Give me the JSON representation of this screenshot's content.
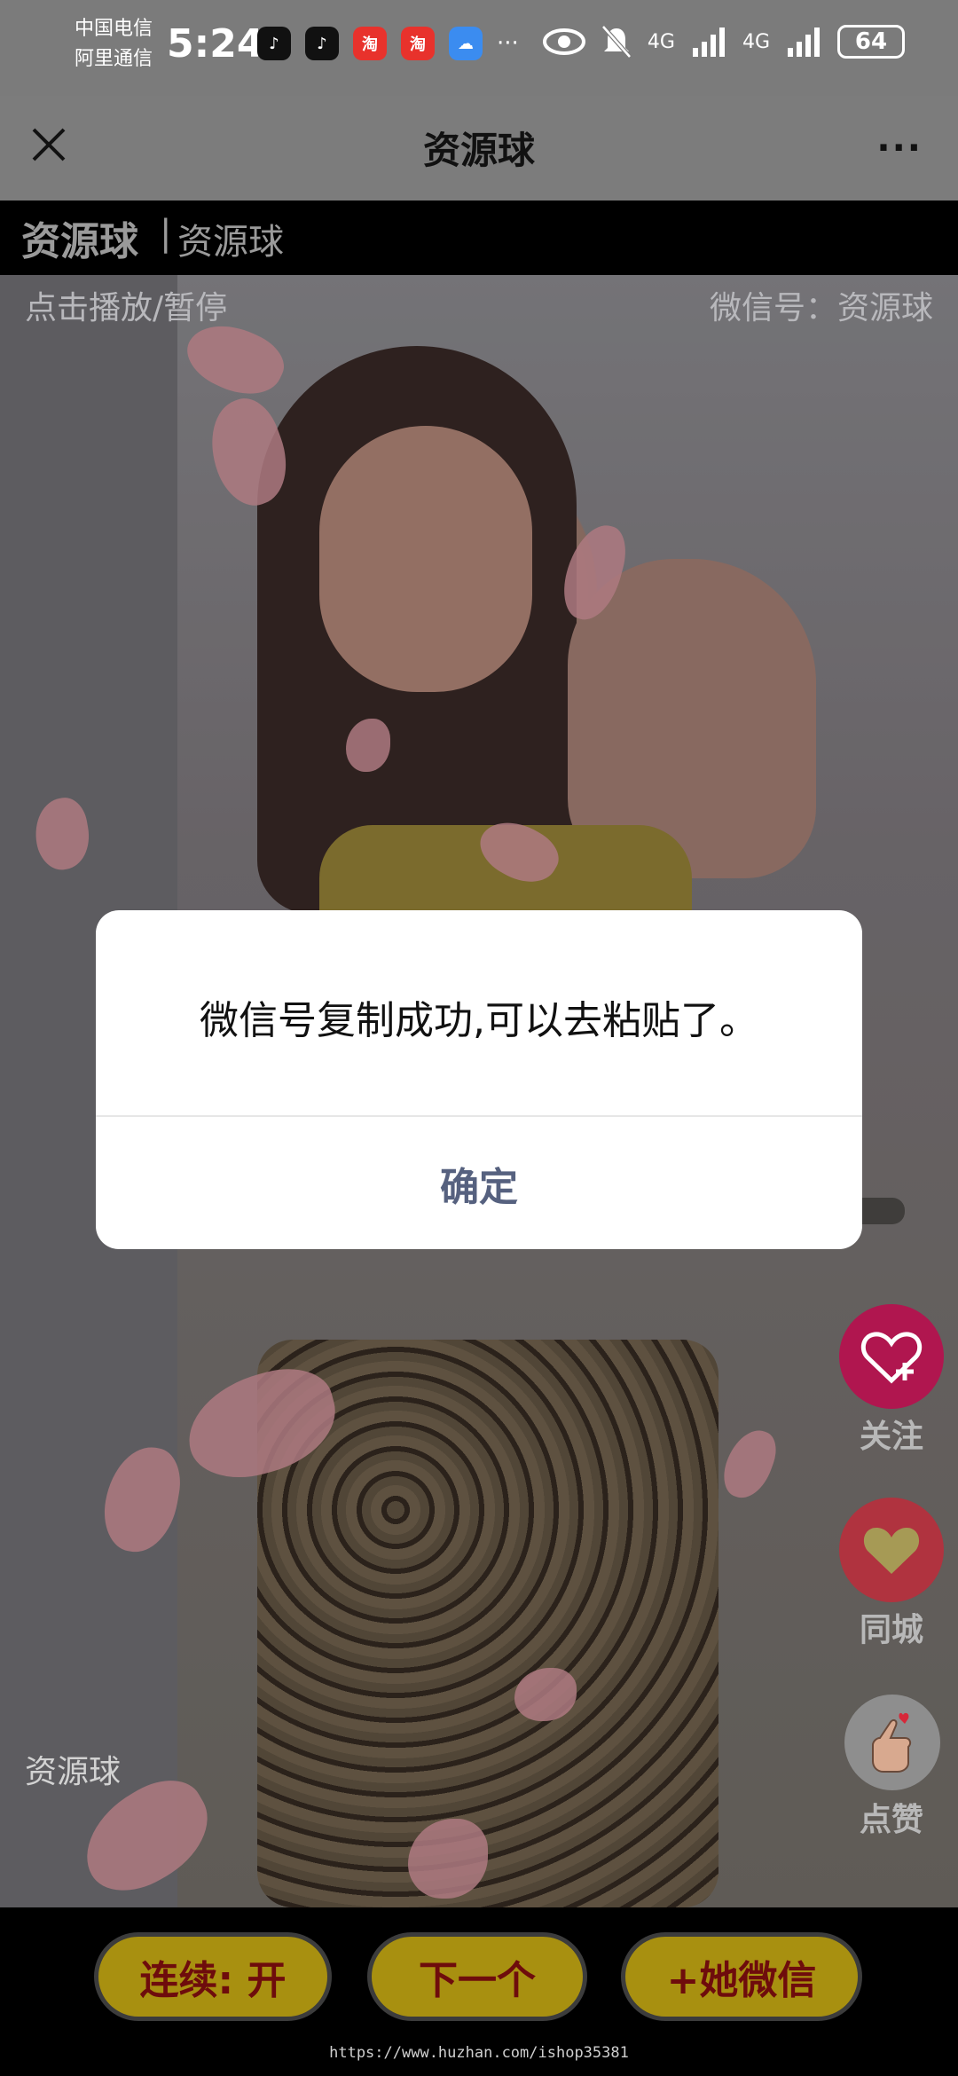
{
  "status_bar": {
    "carrier_1": "中国电信",
    "carrier_2": "阿里通信",
    "time": "5:24",
    "more": "···",
    "network_1": "4G",
    "network_2": "4G",
    "battery": "64"
  },
  "nav": {
    "title": "资源球",
    "more": "···"
  },
  "header": {
    "brand": "资源球",
    "separator": "|",
    "subtitle": "资源球"
  },
  "video": {
    "play_hint": "点击播放/暂停",
    "wechat_id": "微信号：资源球",
    "bottom_name": "资源球",
    "side": {
      "follow_label": "关注",
      "city_label": "同城",
      "like_label": "点赞"
    }
  },
  "dialog": {
    "message": "微信号复制成功,可以去粘贴了。",
    "confirm": "确定"
  },
  "bottom": {
    "continuous": "连续: 开",
    "next": "下一个",
    "add_wechat": "+她微信",
    "url": "https://www.huzhan.com/ishop35381"
  },
  "colors": {
    "dialog_confirm": "#56617f",
    "bottom_button": "#a89010",
    "follow_button": "#b0164f",
    "city_button": "#b0333f"
  }
}
